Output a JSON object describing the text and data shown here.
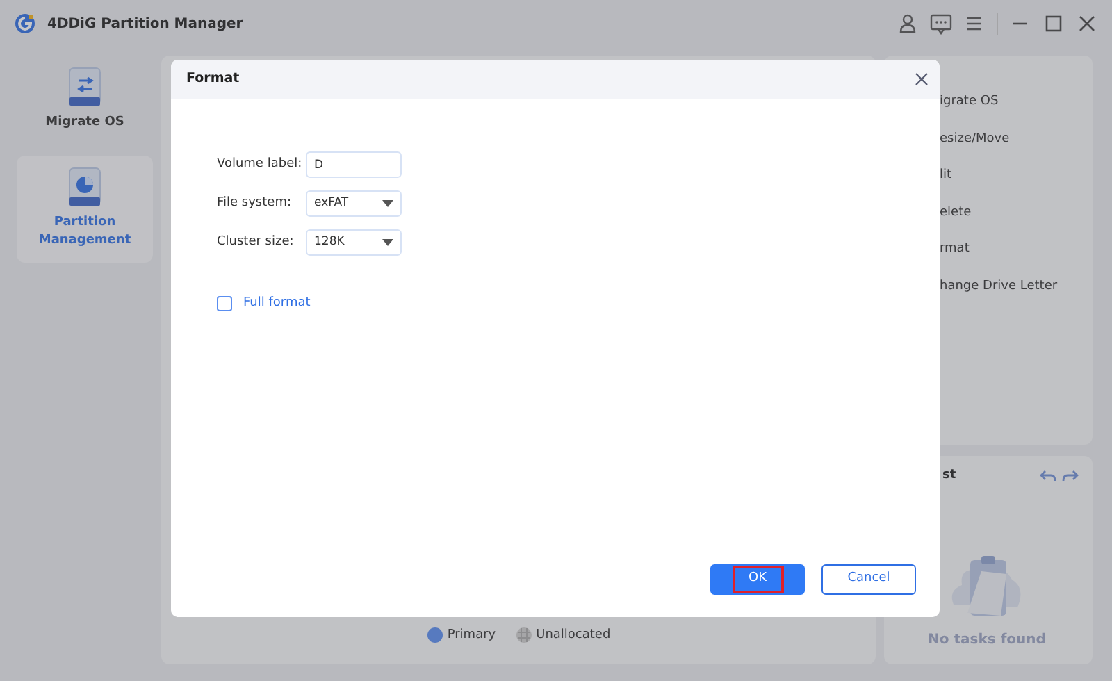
{
  "window": {
    "title": "4DDiG Partition Manager"
  },
  "sidebar": {
    "items": [
      {
        "label": "Migrate OS",
        "selected": false,
        "kind": "migrate"
      },
      {
        "label": "Partition Management",
        "selected": true,
        "kind": "partition"
      }
    ]
  },
  "actions": [
    "igrate OS",
    "esize/Move",
    "lit",
    "elete",
    "rmat",
    "hange Drive Letter"
  ],
  "legend": [
    {
      "label": "Primary",
      "kind": "primary"
    },
    {
      "label": "Unallocated",
      "kind": "unallocated"
    }
  ],
  "task_list": {
    "title": "st",
    "empty_text": "No tasks found"
  },
  "dialog": {
    "title": "Format",
    "fields": [
      {
        "label": "Volume label:",
        "kind": "text",
        "value": "D"
      },
      {
        "label": "File system:",
        "kind": "select",
        "value": "exFAT"
      },
      {
        "label": "Cluster size:",
        "kind": "select",
        "value": "128K"
      }
    ],
    "full_format": {
      "label": "Full format",
      "checked": false
    },
    "buttons": [
      {
        "label": "OK",
        "kind": "primary",
        "focused": true
      },
      {
        "label": "Cancel",
        "kind": "secondary",
        "focused": false
      }
    ]
  }
}
